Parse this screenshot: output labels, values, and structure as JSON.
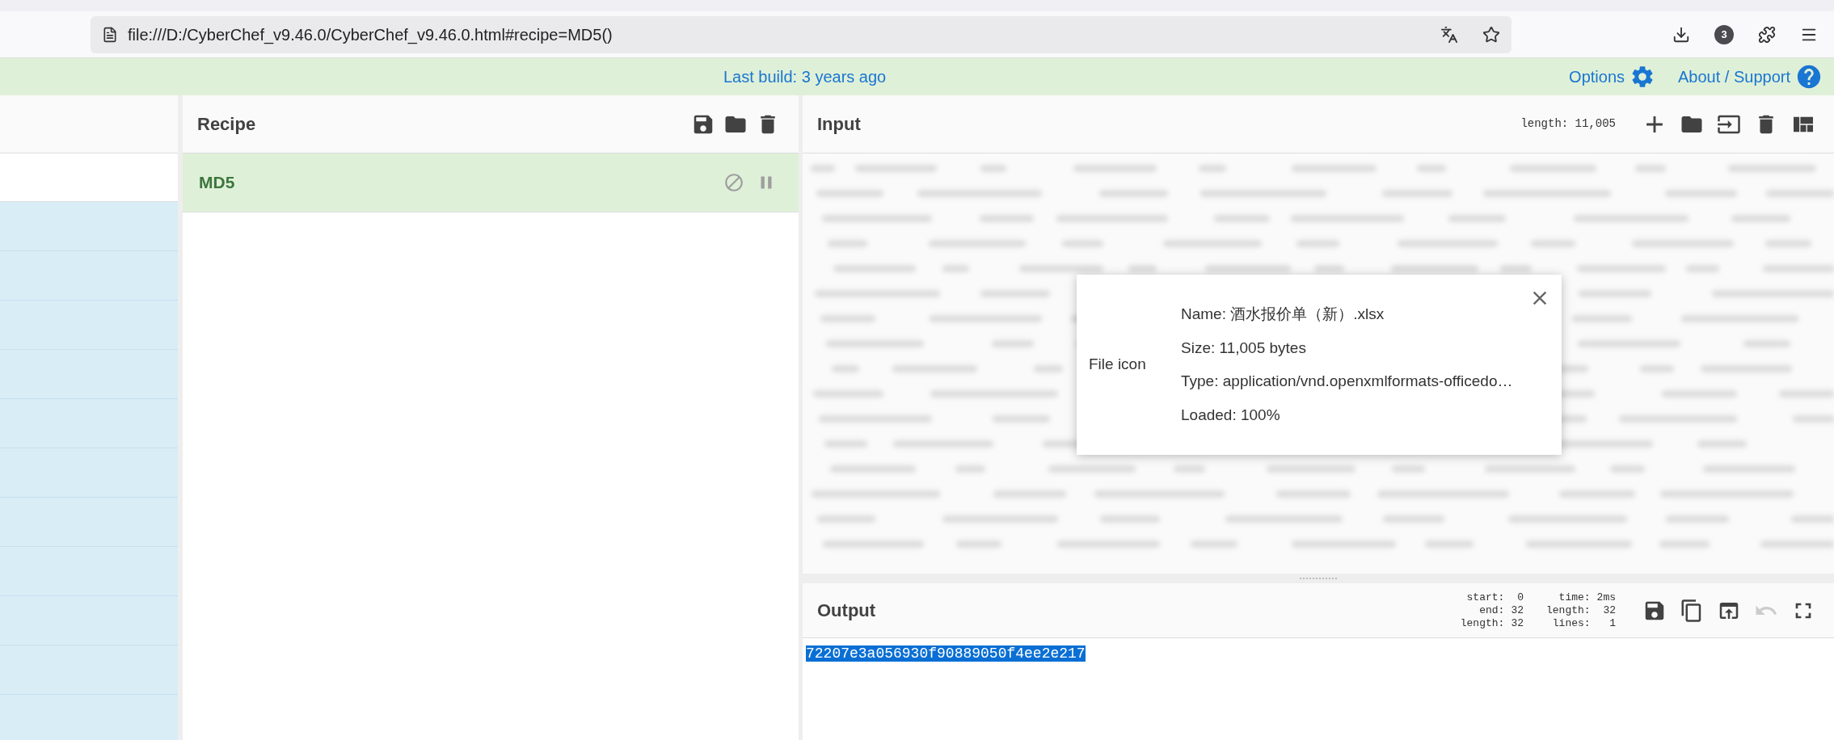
{
  "browser": {
    "url": "file:///D:/CyberChef_v9.46.0/CyberChef_v9.46.0.html#recipe=MD5()",
    "downloads_badge": "3"
  },
  "banner": {
    "text": "Last build: 3 years ago",
    "options": "Options",
    "about": "About / Support"
  },
  "recipe": {
    "title": "Recipe",
    "operations": [
      {
        "name": "MD5",
        "disabled": false
      }
    ]
  },
  "input": {
    "title": "Input",
    "length_label": "length: 11,005",
    "file": {
      "icon_label": "File icon",
      "lines": [
        "Name: 酒水报价单（新）.xlsx",
        "Size: 11,005 bytes",
        "Type: application/vnd.openxmlformats-officedo…",
        "Loaded: 100%"
      ]
    }
  },
  "output": {
    "title": "Output",
    "stats": [
      {
        "label": "start:",
        "value": "0"
      },
      {
        "label": "end:",
        "value": "32"
      },
      {
        "label": "length:",
        "value": "32"
      },
      {
        "label": "time:",
        "value": "2ms"
      },
      {
        "label": "length:",
        "value": "32"
      },
      {
        "label": "lines:",
        "value": "1"
      }
    ],
    "undo_disabled": true,
    "value": "72207e3a056930f90889050f4ee2e217",
    "selected": true
  }
}
